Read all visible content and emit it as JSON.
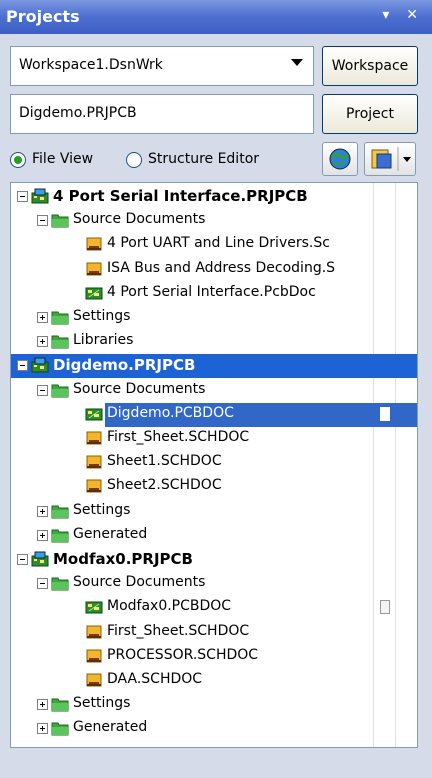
{
  "panel": {
    "title": "Projects",
    "controls": "▾ ✕"
  },
  "workspace": {
    "combo_value": "Workspace1.DsnWrk",
    "button_label": "Workspace"
  },
  "project": {
    "field_value": "Digdemo.PRJPCB",
    "button_label": "Project"
  },
  "view_mode": {
    "options": [
      "File View",
      "Structure Editor"
    ],
    "selected": "File View"
  },
  "tree": {
    "rows": [
      {
        "label": "4 Port Serial Interface.PRJPCB",
        "level": 0,
        "type": "project",
        "expanded": true
      },
      {
        "label": "Source Documents",
        "level": 1,
        "type": "folder",
        "expanded": true
      },
      {
        "label": "4 Port UART and Line Drivers.Sc",
        "level": 2,
        "type": "sch"
      },
      {
        "label": "ISA Bus and Address Decoding.S",
        "level": 2,
        "type": "sch"
      },
      {
        "label": "4 Port Serial Interface.PcbDoc",
        "level": 2,
        "type": "pcb"
      },
      {
        "label": "Settings",
        "level": 1,
        "type": "folder",
        "expanded": false
      },
      {
        "label": "Libraries",
        "level": 1,
        "type": "folder",
        "expanded": false
      },
      {
        "label": "Digdemo.PRJPCB",
        "level": 0,
        "type": "project",
        "expanded": true,
        "selected": true
      },
      {
        "label": "Source Documents",
        "level": 1,
        "type": "folder",
        "expanded": true
      },
      {
        "label": "Digdemo.PCBDOC",
        "level": 2,
        "type": "pcb",
        "highlighted": true,
        "status": true
      },
      {
        "label": "First_Sheet.SCHDOC",
        "level": 2,
        "type": "sch"
      },
      {
        "label": "Sheet1.SCHDOC",
        "level": 2,
        "type": "sch"
      },
      {
        "label": "Sheet2.SCHDOC",
        "level": 2,
        "type": "sch"
      },
      {
        "label": "Settings",
        "level": 1,
        "type": "folder",
        "expanded": false
      },
      {
        "label": "Generated",
        "level": 1,
        "type": "folder",
        "expanded": false
      },
      {
        "label": "Modfax0.PRJPCB",
        "level": 0,
        "type": "project",
        "expanded": true
      },
      {
        "label": "Source Documents",
        "level": 1,
        "type": "folder",
        "expanded": true
      },
      {
        "label": "Modfax0.PCBDOC",
        "level": 2,
        "type": "pcb",
        "status": true
      },
      {
        "label": "First_Sheet.SCHDOC",
        "level": 2,
        "type": "sch"
      },
      {
        "label": "PROCESSOR.SCHDOC",
        "level": 2,
        "type": "sch"
      },
      {
        "label": "DAA.SCHDOC",
        "level": 2,
        "type": "sch"
      },
      {
        "label": "Settings",
        "level": 1,
        "type": "folder",
        "expanded": false
      },
      {
        "label": "Generated",
        "level": 1,
        "type": "folder",
        "expanded": false
      }
    ]
  },
  "colors": {
    "title_bar": "#4c6fd1",
    "selection": "#1e63d6",
    "folder": "#3ea83e",
    "sch_doc": "#f2b52b",
    "pcb_doc": "#2e8b2e"
  }
}
